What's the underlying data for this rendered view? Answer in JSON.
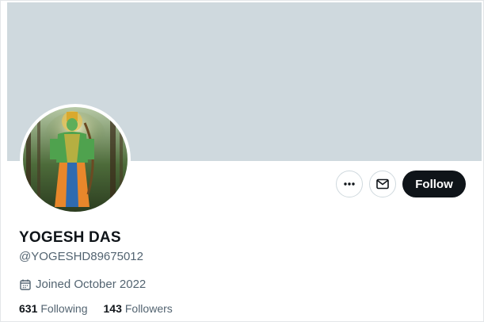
{
  "profile": {
    "display_name": "YOGESH DAS",
    "handle": "@YOGESHD89675012",
    "joined": "Joined October 2022",
    "avatar_icon": "profile-avatar-image",
    "banner_color": "#cfd9de"
  },
  "actions": {
    "more_icon": "more-dots-icon",
    "message_icon": "envelope-icon",
    "follow_label": "Follow"
  },
  "stats": {
    "following_count": "631",
    "following_label": "Following",
    "followers_count": "143",
    "followers_label": "Followers"
  },
  "icons": {
    "joined_icon": "calendar-icon"
  }
}
